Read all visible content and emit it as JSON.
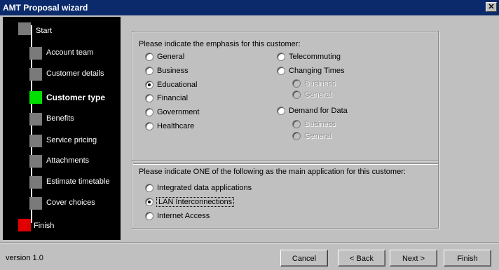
{
  "window": {
    "title": "AMT Proposal  wizard",
    "close_glyph": "✕"
  },
  "sidebar": {
    "steps": [
      {
        "label": "Start",
        "state": "done"
      },
      {
        "label": "Account team",
        "state": "pending"
      },
      {
        "label": "Customer details",
        "state": "pending"
      },
      {
        "label": "Customer type",
        "state": "current"
      },
      {
        "label": "Benefits",
        "state": "pending"
      },
      {
        "label": "Service pricing",
        "state": "pending"
      },
      {
        "label": "Attachments",
        "state": "pending"
      },
      {
        "label": "Estimate timetable",
        "state": "pending"
      },
      {
        "label": "Cover choices",
        "state": "pending"
      },
      {
        "label": "Finish",
        "state": "finish"
      }
    ],
    "colors": {
      "current": "#00e000",
      "finish": "#e00000",
      "pending": "#7a7a7a"
    }
  },
  "emphasis": {
    "prompt": "Please indicate the emphasis for this customer:",
    "options_left": [
      {
        "label": "General",
        "checked": false
      },
      {
        "label": "Business",
        "checked": false
      },
      {
        "label": "Educational",
        "checked": true
      },
      {
        "label": "Financial",
        "checked": false
      },
      {
        "label": "Government",
        "checked": false
      },
      {
        "label": "Healthcare",
        "checked": false
      }
    ],
    "options_right": [
      {
        "label": "Telecommuting",
        "checked": false
      },
      {
        "label": "Changing Times",
        "checked": false
      },
      {
        "label": "Business",
        "checked": false,
        "disabled": true
      },
      {
        "label": "General",
        "checked": false,
        "disabled": true
      },
      {
        "label": "Demand for Data",
        "checked": false
      },
      {
        "label": "Business",
        "checked": false,
        "disabled": true
      },
      {
        "label": "General",
        "checked": false,
        "disabled": true
      }
    ]
  },
  "application": {
    "prompt": "Please indicate ONE of the following as the main application for this customer:",
    "options": [
      {
        "label": "Integrated data applications",
        "checked": false
      },
      {
        "label": "LAN Interconnections",
        "checked": true
      },
      {
        "label": "Internet Access",
        "checked": false
      }
    ]
  },
  "footer": {
    "version": "version 1.0",
    "cancel": "Cancel",
    "back": "< Back",
    "next": "Next >",
    "finish": "Finish"
  }
}
